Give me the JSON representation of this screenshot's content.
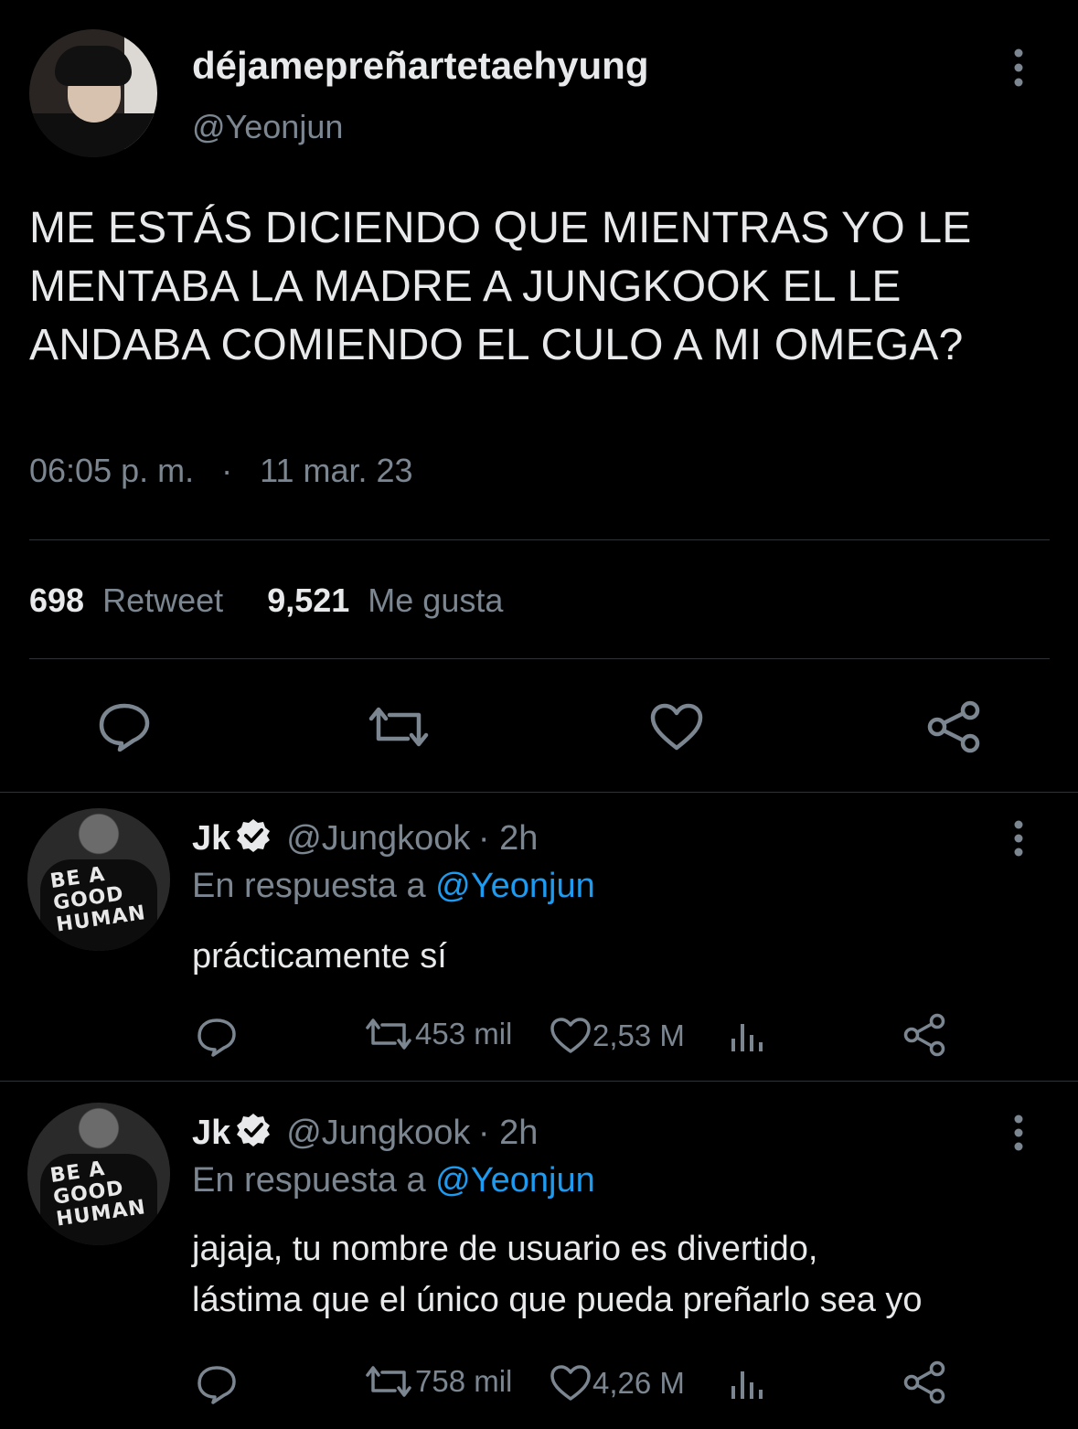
{
  "main_tweet": {
    "display_name": "déjamepreñartetaehyung",
    "handle": "@Yeonjun",
    "text_lines": [
      "ME ESTÁS DICIENDO QUE MIENTRAS YO LE",
      "MENTABA LA MADRE A JUNGKOOK EL LE",
      "ANDABA COMIENDO EL CULO A MI OMEGA?"
    ],
    "time": "06:05 p. m.",
    "separator": "·",
    "date": "11 mar. 23",
    "retweets_count": "698",
    "retweets_label": "Retweet",
    "likes_count": "9,521",
    "likes_label": "Me gusta"
  },
  "replies": [
    {
      "name": "Jk",
      "handle": "@Jungkook",
      "time": "· 2h",
      "reply_to_label": "En respuesta a",
      "reply_to_handle": "@Yeonjun",
      "text_lines": [
        "prácticamente sí"
      ],
      "retweets": "453 mil",
      "likes": "2,53 M",
      "avatar_text": [
        "BE A",
        "GOOD",
        "HUMAN"
      ]
    },
    {
      "name": "Jk",
      "handle": "@Jungkook",
      "time": "· 2h",
      "reply_to_label": "En respuesta a",
      "reply_to_handle": "@Yeonjun",
      "text_lines": [
        "jajaja, tu nombre de usuario es divertido,",
        "lástima que el único que pueda preñarlo sea yo"
      ],
      "retweets": "758 mil",
      "likes": "4,26 M",
      "avatar_text": [
        "BE A",
        "GOOD",
        "HUMAN"
      ]
    }
  ],
  "colors": {
    "background": "#000000",
    "text": "#e7e9ea",
    "muted": "#7b8691",
    "link": "#1d9bf0",
    "divider": "#2f3336"
  },
  "icons": [
    "more-icon",
    "reply-icon",
    "retweet-icon",
    "like-icon",
    "share-icon",
    "verified-icon",
    "views-icon"
  ]
}
